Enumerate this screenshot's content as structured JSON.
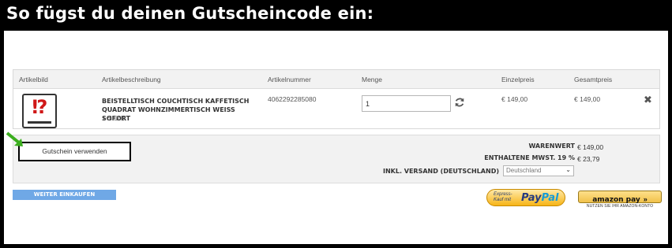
{
  "banner": {
    "title": "So fügst du deinen Gutscheincode ein:"
  },
  "cart": {
    "headers": {
      "image": "Artikelbild",
      "description": "Artikelbeschreibung",
      "number": "Artikelnummer",
      "quantity": "Menge",
      "unit_price": "Einzelpreis",
      "total_price": "Gesamtpreis"
    },
    "item": {
      "title": "BEISTELLTISCH COUCHTISCH KAFFETISCH QUADRAT WOHNZIMMERTISCH WEISS SOFORT",
      "qty_text": "1 Stück",
      "number": "4062292285080",
      "quantity": "1",
      "unit_price": "€ 149,00",
      "total_price": "€ 149,00",
      "image_icon": "question-exclamation-icon"
    }
  },
  "coupon": {
    "button_label": "Gutschein verwenden",
    "arrow_color": "#3cae1f"
  },
  "summary": {
    "goods_label": "WARENWERT",
    "goods_value": "€ 149,00",
    "vat_label": "ENTHALTENE MWST. 19 %",
    "vat_value": "€ 23,79",
    "shipping_label": "INKL. VERSAND (DEUTSCHLAND)",
    "shipping_select": "Deutschland"
  },
  "actions": {
    "continue_label": "WEITER EINKAUFEN",
    "paypal_pre": "Express-Kauf mit",
    "paypal_logo_a": "Pay",
    "paypal_logo_b": "Pal",
    "amazon_label": "amazon pay",
    "amazon_chevron": "»",
    "amazon_note": "NUTZEN SIE IHR AMAZON-KONTO"
  },
  "colors": {
    "accent_blue": "#6fa8e6",
    "paypal_yellow": "#f7b417",
    "amazon_yellow": "#f0c14b"
  }
}
